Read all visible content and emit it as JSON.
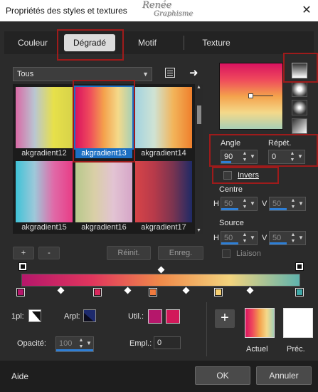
{
  "window": {
    "title": "Propriétés des styles et textures",
    "close_glyph": "✕",
    "watermark_top": "Renée",
    "watermark_bottom": "Graphisme"
  },
  "tabs": [
    {
      "label": "Couleur"
    },
    {
      "label": "Dégradé",
      "active": true
    },
    {
      "label": "Motif"
    },
    {
      "label": "Texture"
    }
  ],
  "category": {
    "value": "Tous"
  },
  "gradients": [
    {
      "name": "akgradient12",
      "colors": [
        "#d96aa6",
        "#b9c6d2",
        "#e7e04a",
        "#d7d34a"
      ]
    },
    {
      "name": "akgradient13",
      "colors": [
        "#d91360",
        "#ef4a5c",
        "#f4a24c",
        "#f4d98a",
        "#a7d0b6"
      ],
      "selected": true
    },
    {
      "name": "akgradient14",
      "colors": [
        "#a3d3e0",
        "#cfe3d4",
        "#f2b45a",
        "#ef7f2c"
      ]
    },
    {
      "name": "akgradient15",
      "colors": [
        "#3fc3d8",
        "#9ec8d9",
        "#e06aa8",
        "#e83d86"
      ]
    },
    {
      "name": "akgradient16",
      "colors": [
        "#b7c88c",
        "#d9cfa6",
        "#e2c3d3",
        "#d6a6c8"
      ]
    },
    {
      "name": "akgradient17",
      "colors": [
        "#d64448",
        "#b73a4a",
        "#7a3450",
        "#1e2a66"
      ]
    }
  ],
  "list_buttons": {
    "add": "+",
    "remove": "-",
    "reset": "Réinit.",
    "save": "Enreg."
  },
  "preview": {
    "colors": [
      "#d91360",
      "#ef4a5c",
      "#f4a24c",
      "#f4d98a",
      "#a7d0b6"
    ]
  },
  "params": {
    "angle_label": "Angle",
    "angle_value": "90",
    "repeat_label": "Répét.",
    "repeat_value": "0",
    "invert_label": "Invers",
    "center_label": "Centre",
    "center_h": "50",
    "center_v": "50",
    "source_label": "Source",
    "source_h": "50",
    "source_v": "50",
    "link_label": "Liaison",
    "h_label": "H",
    "v_label": "V"
  },
  "editor": {
    "bar_colors": [
      "#b5176b",
      "#e0355d",
      "#ef8a4a",
      "#f3d47e",
      "#5fb3ad"
    ],
    "stops": [
      {
        "color": "#b5176b",
        "pos": 0
      },
      {
        "color": "#d8285c",
        "pos": 27.5
      },
      {
        "color": "#ef7a3e",
        "pos": 47.5
      },
      {
        "color": "#f6cf72",
        "pos": 71
      },
      {
        "color": "#3fa7a6",
        "pos": 100
      }
    ],
    "midpoints": [
      14,
      38,
      59,
      82
    ],
    "transparency_mid": 50
  },
  "bottom": {
    "one_pl_label": "1pl:",
    "arpl_label": "Arpl:",
    "util_label": "Util.:",
    "util_colors": [
      "#b5176b",
      "#d2185a"
    ],
    "opacity_label": "Opacité:",
    "opacity_value": "100",
    "empl_label": "Empl.:",
    "empl_value": "0",
    "add_glyph": "+",
    "actual_label": "Actuel",
    "previous_label": "Préc.",
    "previous_color": "#ffffff"
  },
  "footer": {
    "help": "Aide",
    "ok": "OK",
    "cancel": "Annuler"
  }
}
